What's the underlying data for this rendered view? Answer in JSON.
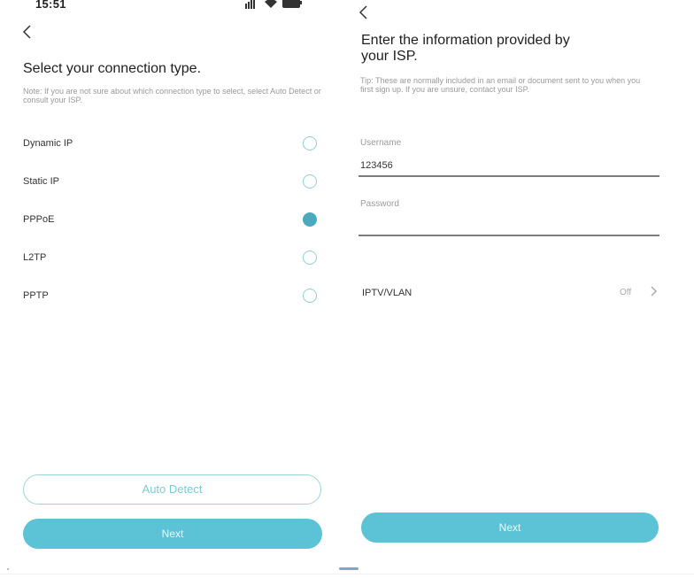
{
  "left": {
    "status": {
      "time": "15:51",
      "icons": [
        "signal-icon",
        "wifi-icon",
        "battery-icon"
      ]
    },
    "title": "Select your connection type.",
    "note": "Note: If you are not sure about which connection type to select, select Auto Detect or consult your ISP.",
    "options": [
      {
        "label": "Dynamic IP",
        "selected": false
      },
      {
        "label": "Static IP",
        "selected": false
      },
      {
        "label": "PPPoE",
        "selected": true
      },
      {
        "label": "L2TP",
        "selected": false
      },
      {
        "label": "PPTP",
        "selected": false
      }
    ],
    "auto_detect_label": "Auto Detect",
    "next_label": "Next"
  },
  "right": {
    "title_line1": "Enter the information provided by",
    "title_line2": "your ISP.",
    "tip": "Tip: These are normally included in an email or document sent to you when you first sign up. If you are unsure, contact your ISP.",
    "username_label": "Username",
    "username_value": "123456",
    "password_label": "Password",
    "password_value": "",
    "iptv_label": "IPTV/VLAN",
    "iptv_value": "Off",
    "next_label": "Next"
  },
  "colors": {
    "accent": "#5cc2d5",
    "radio_checked": "#4aa9bd",
    "outline": "#9fd3da"
  }
}
